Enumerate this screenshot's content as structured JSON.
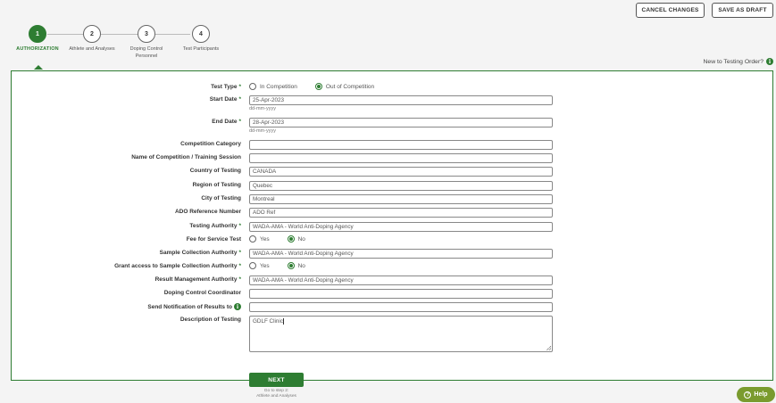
{
  "header": {
    "cancel_label": "CANCEL CHANGES",
    "draft_label": "SAVE AS DRAFT",
    "new_to_label": "New to Testing Order?"
  },
  "steps": [
    {
      "number": "1",
      "label": "AUTHORIZATION",
      "active": true
    },
    {
      "number": "2",
      "label": "Athlete and Analyses",
      "active": false
    },
    {
      "number": "3",
      "label": "Doping Control Personnel",
      "active": false
    },
    {
      "number": "4",
      "label": "Test Participants",
      "active": false
    }
  ],
  "form": {
    "test_type": {
      "label": "Test Type",
      "required": true,
      "options": [
        "In Competition",
        "Out of Competition"
      ],
      "selected": "Out of Competition"
    },
    "start_date": {
      "label": "Start Date",
      "required": true,
      "value": "25-Apr-2023",
      "hint": "dd-mm-yyyy"
    },
    "end_date": {
      "label": "End Date",
      "required": true,
      "value": "28-Apr-2023",
      "hint": "dd-mm-yyyy"
    },
    "competition_category": {
      "label": "Competition Category",
      "value": ""
    },
    "competition_name": {
      "label": "Name of Competition / Training Session",
      "value": ""
    },
    "country": {
      "label": "Country of Testing",
      "value": "CANADA"
    },
    "region": {
      "label": "Region of Testing",
      "value": "Quebec"
    },
    "city": {
      "label": "City of Testing",
      "value": "Montreal"
    },
    "ado_ref": {
      "label": "ADO Reference Number",
      "value": "ADO Ref"
    },
    "testing_authority": {
      "label": "Testing Authority",
      "required": true,
      "value": "WADA-AMA - World Anti-Doping Agency"
    },
    "fee_for_service": {
      "label": "Fee for Service Test",
      "options": [
        "Yes",
        "No"
      ],
      "selected": "No"
    },
    "sample_collection_authority": {
      "label": "Sample Collection Authority",
      "required": true,
      "value": "WADA-AMA - World Anti-Doping Agency"
    },
    "grant_access": {
      "label": "Grant access to Sample Collection Authority",
      "required": true,
      "options": [
        "Yes",
        "No"
      ],
      "selected": "No"
    },
    "result_management_authority": {
      "label": "Result Management Authority",
      "required": true,
      "value": "WADA-AMA - World Anti-Doping Agency"
    },
    "dcc": {
      "label": "Doping Control Coordinator",
      "value": ""
    },
    "notification": {
      "label": "Send Notification of Results to",
      "value": ""
    },
    "description": {
      "label": "Description of Testing",
      "value": "GDLF Clinic"
    }
  },
  "next": {
    "label": "NEXT",
    "hint_line1": "Go to step 2:",
    "hint_line2": "Athlete and Analyses"
  },
  "help": {
    "label": "Help"
  },
  "colors": {
    "accent": "#2e7d32",
    "help": "#7a9b2e"
  }
}
